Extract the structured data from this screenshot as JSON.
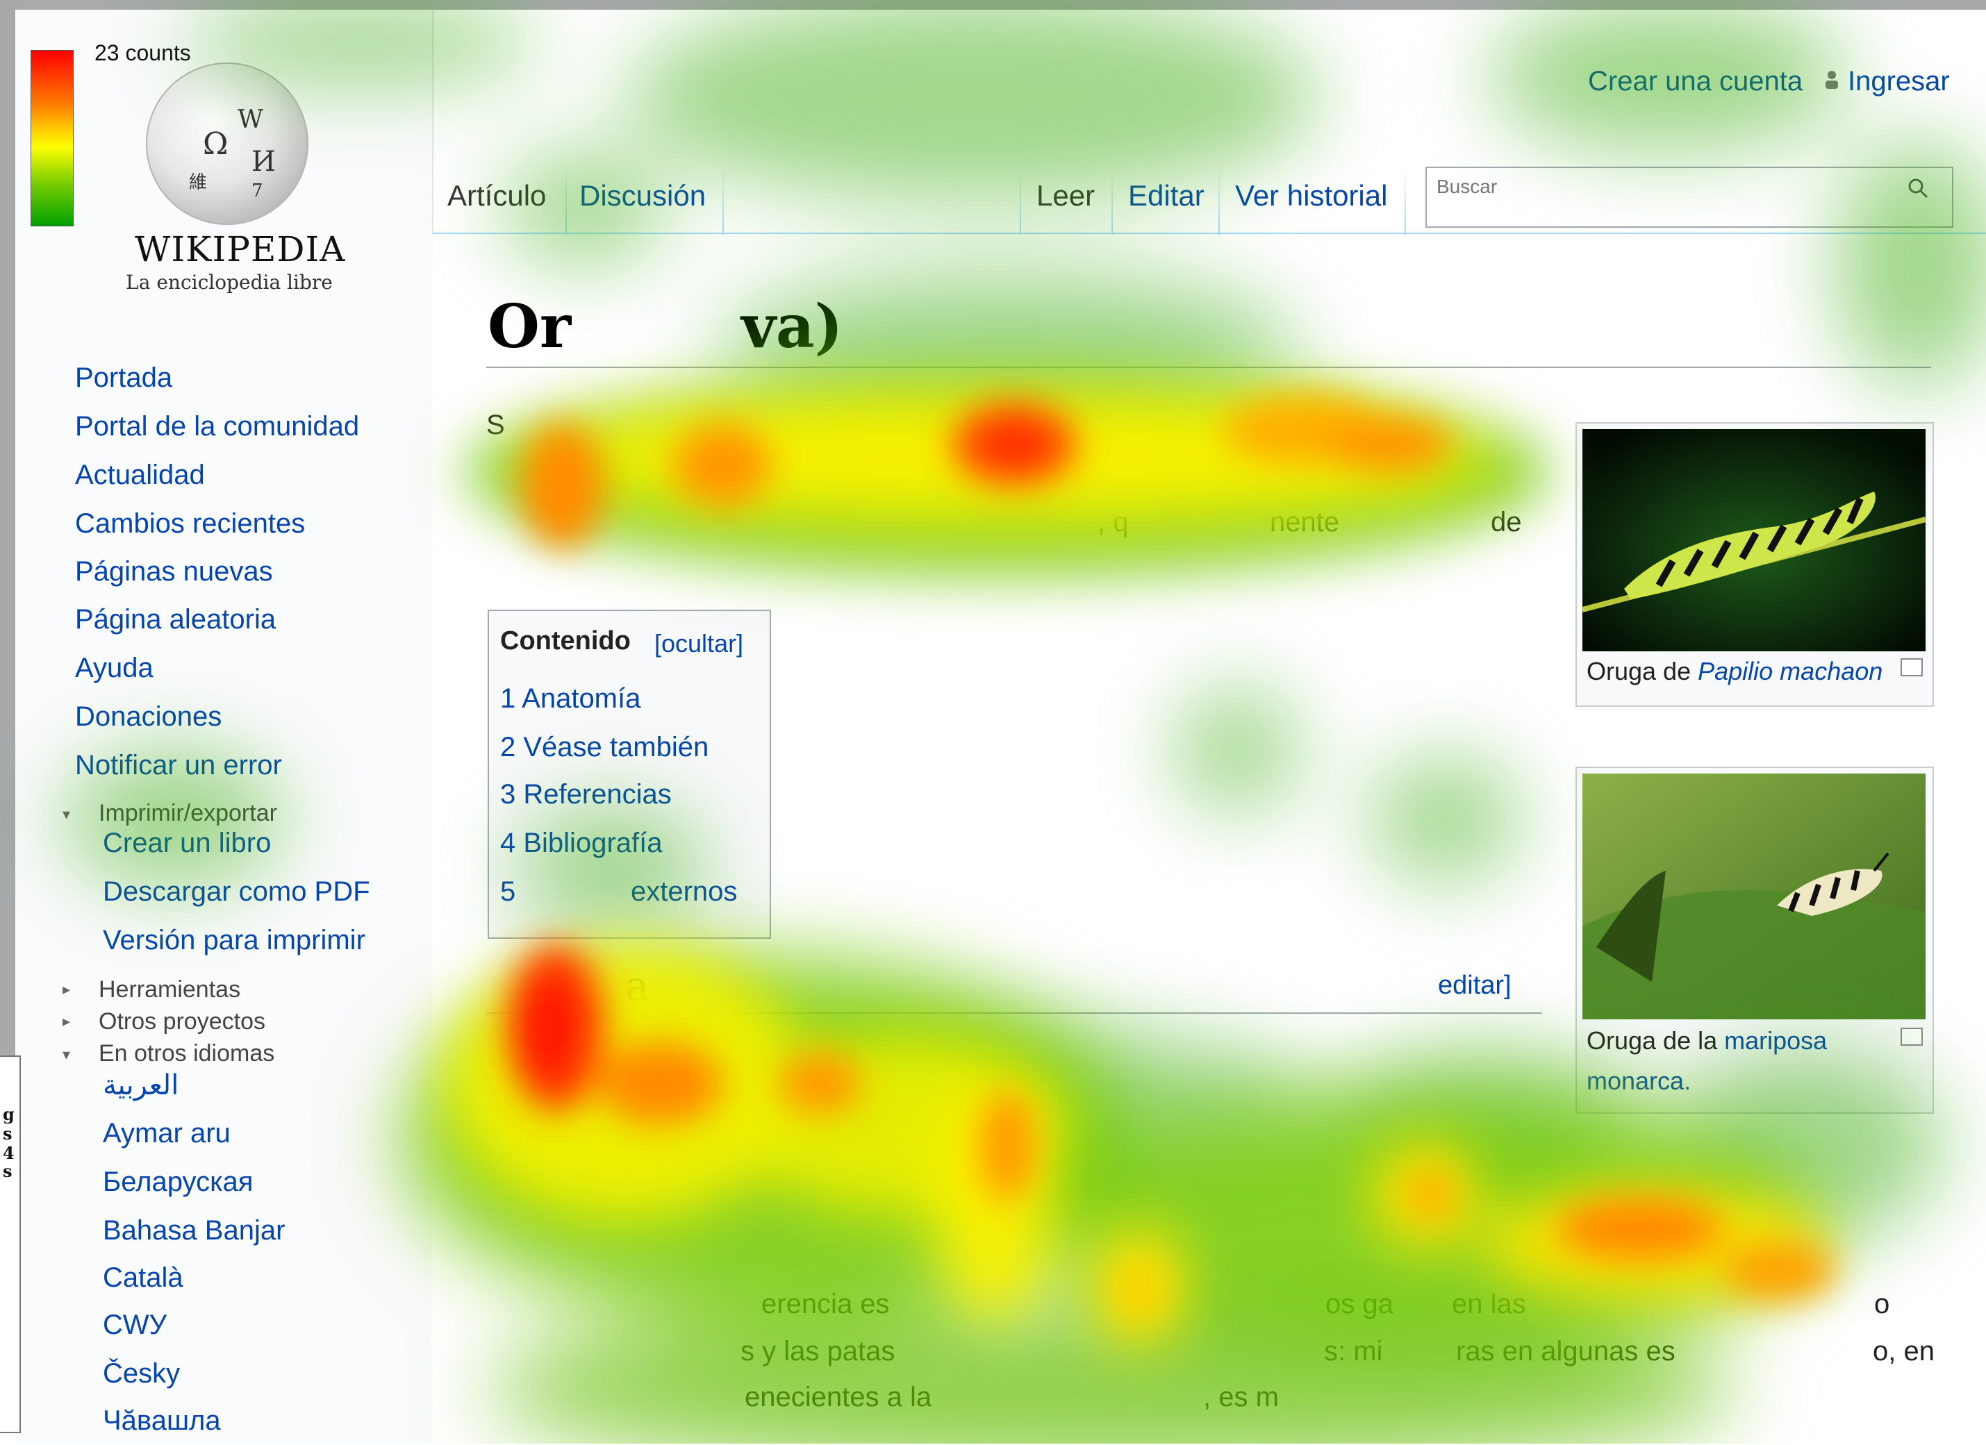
{
  "heatmap": {
    "legend_label": "23 counts",
    "colors": {
      "max": "#ff0000",
      "high": "#ff7a00",
      "mid": "#ffff00",
      "low": "#7ecf00",
      "min": "#00a000"
    }
  },
  "logo": {
    "wordmark": "WIKIPEDIA",
    "tagline": "La enciclopedia libre",
    "globe_glyphs": [
      "Ω",
      "W",
      "И",
      "維",
      "7"
    ]
  },
  "sidebar": {
    "nav": [
      "Portada",
      "Portal de la comunidad",
      "Actualidad",
      "Cambios recientes",
      "Páginas nuevas",
      "Página aleatoria",
      "Ayuda",
      "Donaciones",
      "Notificar un error"
    ],
    "print_export": {
      "heading": "Imprimir/exportar",
      "items": [
        "Crear un libro",
        "Descargar como PDF",
        "Versión para imprimir"
      ]
    },
    "tools_heading": "Herramientas",
    "other_projects_heading": "Otros proyectos",
    "languages": {
      "heading": "En otros idiomas",
      "items": [
        "العربية",
        "Aymar aru",
        "Беларуская",
        "Bahasa Banjar",
        "Català",
        "СWУ",
        "Česky",
        "Чӑвашла"
      ]
    }
  },
  "header": {
    "tabs_left": [
      "Artículo",
      "Discusión"
    ],
    "tabs_right": [
      "Leer",
      "Editar",
      "Ver historial"
    ],
    "search_placeholder": "Buscar",
    "create_account": "Crear una cuenta",
    "login": "Ingresar"
  },
  "article": {
    "title_visible": "Or",
    "title_tail": "va)",
    "lines": [
      {
        "text": "S"
      },
      {
        "text": ", q"
      },
      {
        "text": "nente"
      },
      {
        "text": "de"
      },
      {
        "text": "erencia es"
      },
      {
        "text": "os ga"
      },
      {
        "text": "en las"
      },
      {
        "text": "o"
      },
      {
        "text": "s y las patas"
      },
      {
        "text": "s: mi"
      },
      {
        "text": "ras en algunas es"
      },
      {
        "text": "o, en"
      },
      {
        "text": "enecientes a la"
      },
      {
        "text": ", es m"
      }
    ],
    "toc": {
      "title": "Contenido",
      "toggle": "[ocultar]",
      "items": [
        "1 Anatomía",
        "2 Véase también",
        "3 Referencias",
        "4 Bibliografía",
        "5",
        "externos"
      ]
    },
    "section": {
      "title": "a",
      "edit": "editar]"
    },
    "thumbs": [
      {
        "caption_prefix": "Oruga de ",
        "caption_link": "Papilio machaon"
      },
      {
        "caption_prefix": "Oruga de la ",
        "caption_link": "mariposa",
        "caption_line2": "monarca."
      }
    ]
  },
  "left_fragment": [
    "g",
    "s",
    "4",
    "s"
  ]
}
